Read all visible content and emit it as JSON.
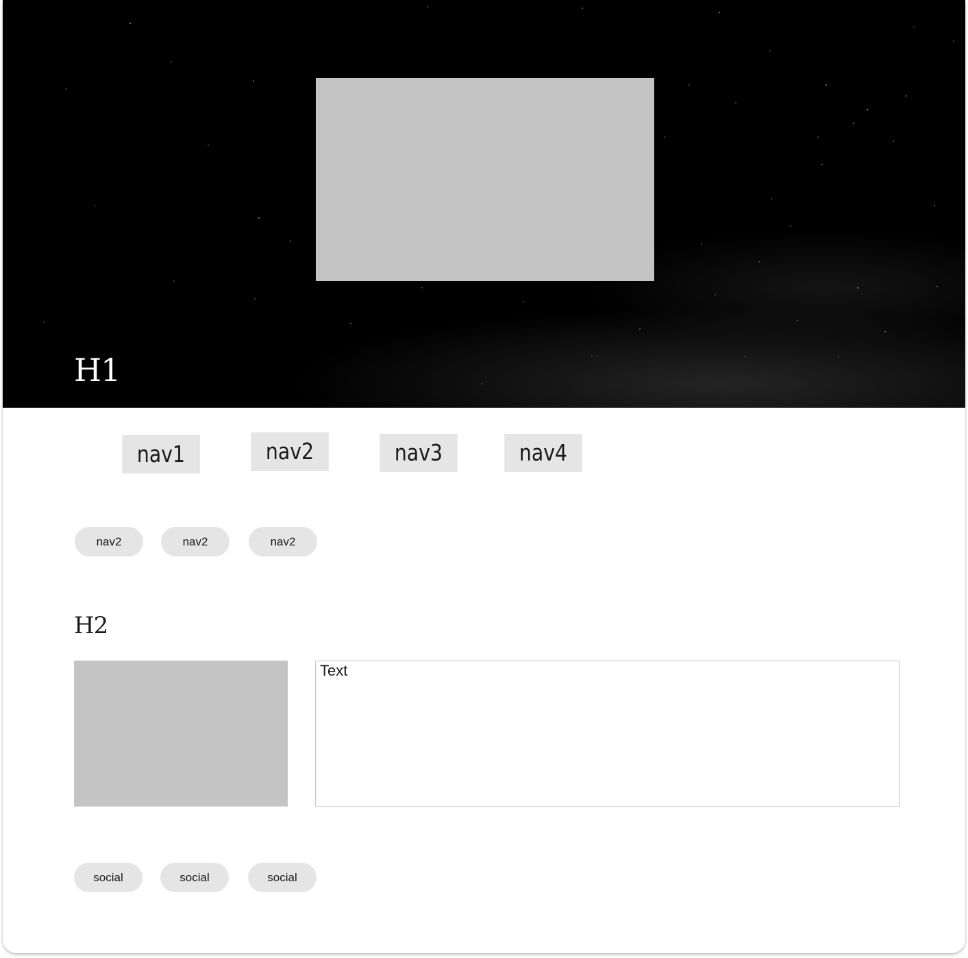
{
  "header": {
    "title": "H1"
  },
  "nav": {
    "primary": [
      "nav1",
      "nav2",
      "nav3",
      "nav4"
    ],
    "secondary": [
      "nav2",
      "nav2",
      "nav2"
    ]
  },
  "content": {
    "heading": "H2",
    "text": "Text"
  },
  "social": [
    "social",
    "social",
    "social"
  ],
  "colors": {
    "hero_background": "#000000",
    "placeholder": "#c4c4c4",
    "button": "#e5e5e5",
    "text": "#1a1a1a"
  }
}
